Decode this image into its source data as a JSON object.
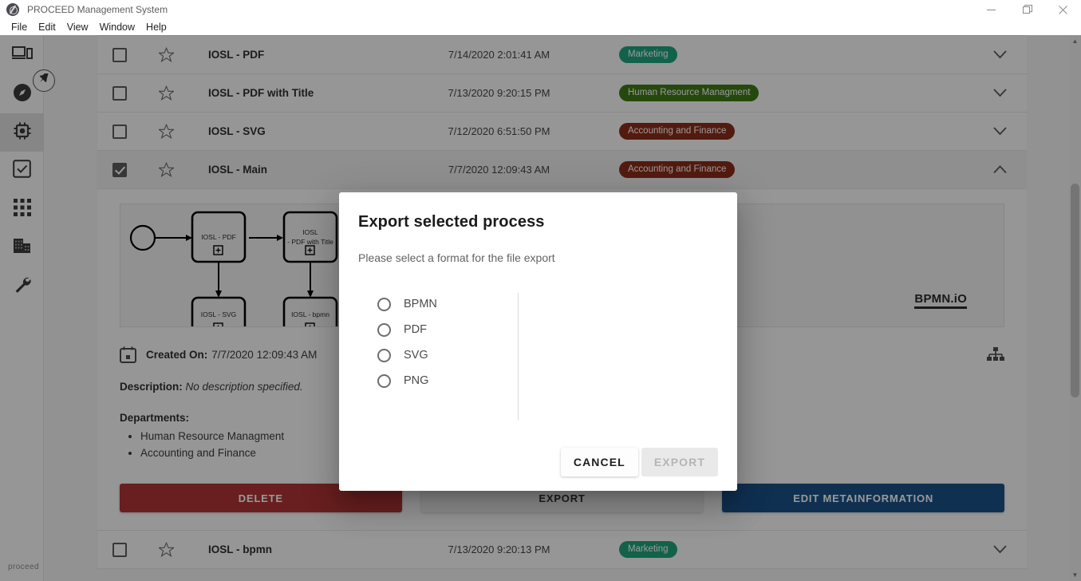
{
  "window": {
    "title": "PROCEED Management System",
    "app_icon": "proceed-logo-icon",
    "minimize_label": "—",
    "maximize_label": "❐",
    "close_label": "✕"
  },
  "menu": {
    "items": [
      {
        "label": "File"
      },
      {
        "label": "Edit"
      },
      {
        "label": "View"
      },
      {
        "label": "Window"
      },
      {
        "label": "Help"
      }
    ]
  },
  "sidebar": {
    "logo_text": "proceed",
    "pin_icon": "pin-icon",
    "items": [
      {
        "icon": "devices-icon",
        "active": false
      },
      {
        "icon": "compass-icon",
        "active": false
      },
      {
        "icon": "processor-chip-icon",
        "active": true
      },
      {
        "icon": "checkbox-task-icon",
        "active": false
      },
      {
        "icon": "grid-apps-icon",
        "active": false
      },
      {
        "icon": "building-icon",
        "active": false
      },
      {
        "icon": "wrench-icon",
        "active": false
      }
    ]
  },
  "process_list": {
    "rows": [
      {
        "name": "IOSL - PDF",
        "date": "7/14/2020 2:01:41 AM",
        "tag": "Marketing",
        "tag_color": "#1fa37e",
        "checked": false,
        "expanded": false,
        "chevron": "chevron-down-icon"
      },
      {
        "name": "IOSL - PDF with Title",
        "date": "7/13/2020 9:20:15 PM",
        "tag": "Human Resource Managment",
        "tag_color": "#3e7a17",
        "checked": false,
        "expanded": false,
        "chevron": "chevron-down-icon"
      },
      {
        "name": "IOSL - SVG",
        "date": "7/12/2020 6:51:50 PM",
        "tag": "Accounting and Finance",
        "tag_color": "#8a2d1c",
        "checked": false,
        "expanded": false,
        "chevron": "chevron-down-icon"
      },
      {
        "name": "IOSL - Main",
        "date": "7/7/2020 12:09:43 AM",
        "tag": "Accounting and Finance",
        "tag_color": "#8a2d1c",
        "checked": true,
        "expanded": true,
        "chevron": "chevron-up-icon"
      },
      {
        "name": "IOSL - bpmn",
        "date": "7/13/2020 9:20:13 PM",
        "tag": "Marketing",
        "tag_color": "#1fa37e",
        "checked": false,
        "expanded": false,
        "chevron": "chevron-down-icon"
      }
    ]
  },
  "detail": {
    "diagram": {
      "watermark": "BPMN.iO",
      "start_event": "start-event",
      "tasks": [
        {
          "label_line1": "IOSL - PDF",
          "label_line2": ""
        },
        {
          "label_line1": "IOSL",
          "label_line2": "- PDF with Title"
        },
        {
          "label_line1": "IOSL - SVG",
          "label_line2": ""
        },
        {
          "label_line1": "IOSL - bpmn",
          "label_line2": ""
        }
      ]
    },
    "created_on_icon": "calendar-icon",
    "created_on_label": "Created On:",
    "created_on_value": "7/7/2020 12:09:43 AM",
    "hierarchy_icon": "hierarchy-icon",
    "description_label": "Description:",
    "description_value": "No description specified.",
    "departments_label": "Departments:",
    "departments": [
      "Human Resource Managment",
      "Accounting and Finance"
    ],
    "buttons": {
      "delete": "DELETE",
      "export": "EXPORT",
      "edit": "EDIT METAINFORMATION"
    }
  },
  "modal": {
    "title": "Export selected process",
    "subtitle": "Please select a format for the file export",
    "options": [
      {
        "label": "BPMN",
        "selected": false
      },
      {
        "label": "PDF",
        "selected": false
      },
      {
        "label": "SVG",
        "selected": false
      },
      {
        "label": "PNG",
        "selected": false
      }
    ],
    "cancel_label": "CANCEL",
    "export_label": "EXPORT",
    "export_disabled": true
  },
  "colors": {
    "accent_blue": "#1b5089",
    "danger_red": "#b03535",
    "tag_marketing": "#1fa37e",
    "tag_hr": "#3e7a17",
    "tag_finance": "#8a2d1c"
  }
}
